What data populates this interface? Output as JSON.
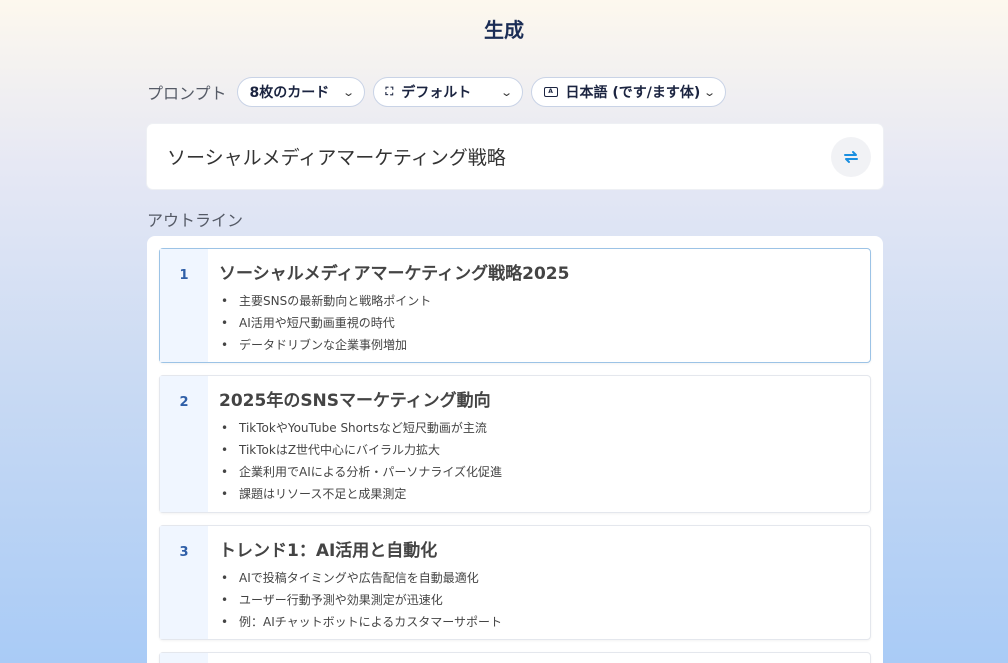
{
  "page": {
    "title": "生成"
  },
  "prompt": {
    "label": "プロンプト",
    "cards_option": "8枚のカード",
    "layout_option": "デフォルト",
    "language_option": "日本語 (です/ます体)",
    "topic": "ソーシャルメディアマーケティング戦略"
  },
  "outline": {
    "label": "アウトライン",
    "slides": [
      {
        "number": "1",
        "title": "ソーシャルメディアマーケティング戦略2025",
        "bullets": [
          "主要SNSの最新動向と戦略ポイント",
          "AI活用や短尺動画重視の時代",
          "データドリブンな企業事例増加"
        ]
      },
      {
        "number": "2",
        "title": "2025年のSNSマーケティング動向",
        "bullets": [
          "TikTokやYouTube Shortsなど短尺動画が主流",
          "TikTokはZ世代中心にバイラル力拡大",
          "企業利用でAIによる分析・パーソナライズ化促進",
          "課題はリソース不足と成果測定"
        ]
      },
      {
        "number": "3",
        "title": "トレンド1：AI活用と自動化",
        "bullets": [
          "AIで投稿タイミングや広告配信を自動最適化",
          "ユーザー行動予測や効果測定が迅速化",
          "例：AIチャットボットによるカスタマーサポート"
        ]
      }
    ]
  },
  "icons": {
    "accent": "#1a8fe0"
  }
}
